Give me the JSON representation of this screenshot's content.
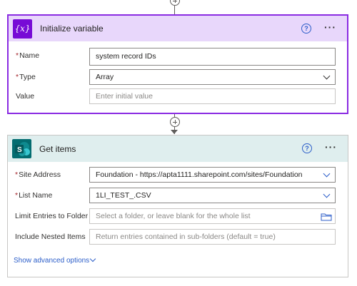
{
  "init_variable": {
    "title": "Initialize variable",
    "icon_text": "{x}",
    "fields": {
      "name_label": "Name",
      "name_value": "system record IDs",
      "type_label": "Type",
      "type_value": "Array",
      "value_label": "Value",
      "value_placeholder": "Enter initial value"
    },
    "required_mark": "*"
  },
  "get_items": {
    "title": "Get items",
    "icon_text": "S",
    "fields": {
      "site_label": "Site Address",
      "site_value": "Foundation - https://apta1111.sharepoint.com/sites/Foundation",
      "list_label": "List Name",
      "list_value": "1LI_TEST_.CSV",
      "limit_label": "Limit Entries to Folder",
      "limit_placeholder": "Select a folder, or leave blank for the whole list",
      "nested_label": "Include Nested Items",
      "nested_placeholder": "Return entries contained in sub-folders (default = true)"
    },
    "advanced_link": "Show advanced options",
    "required_mark": "*"
  },
  "icons": {
    "help": "?",
    "more": "···"
  },
  "colors": {
    "variable_accent": "#770bd6",
    "variable_header_bg": "#e8d7fb",
    "sharepoint_accent": "#036c70",
    "sharepoint_header_bg": "#dfeeee",
    "link_blue": "#2c5ec9",
    "required_red": "#a4262c"
  }
}
